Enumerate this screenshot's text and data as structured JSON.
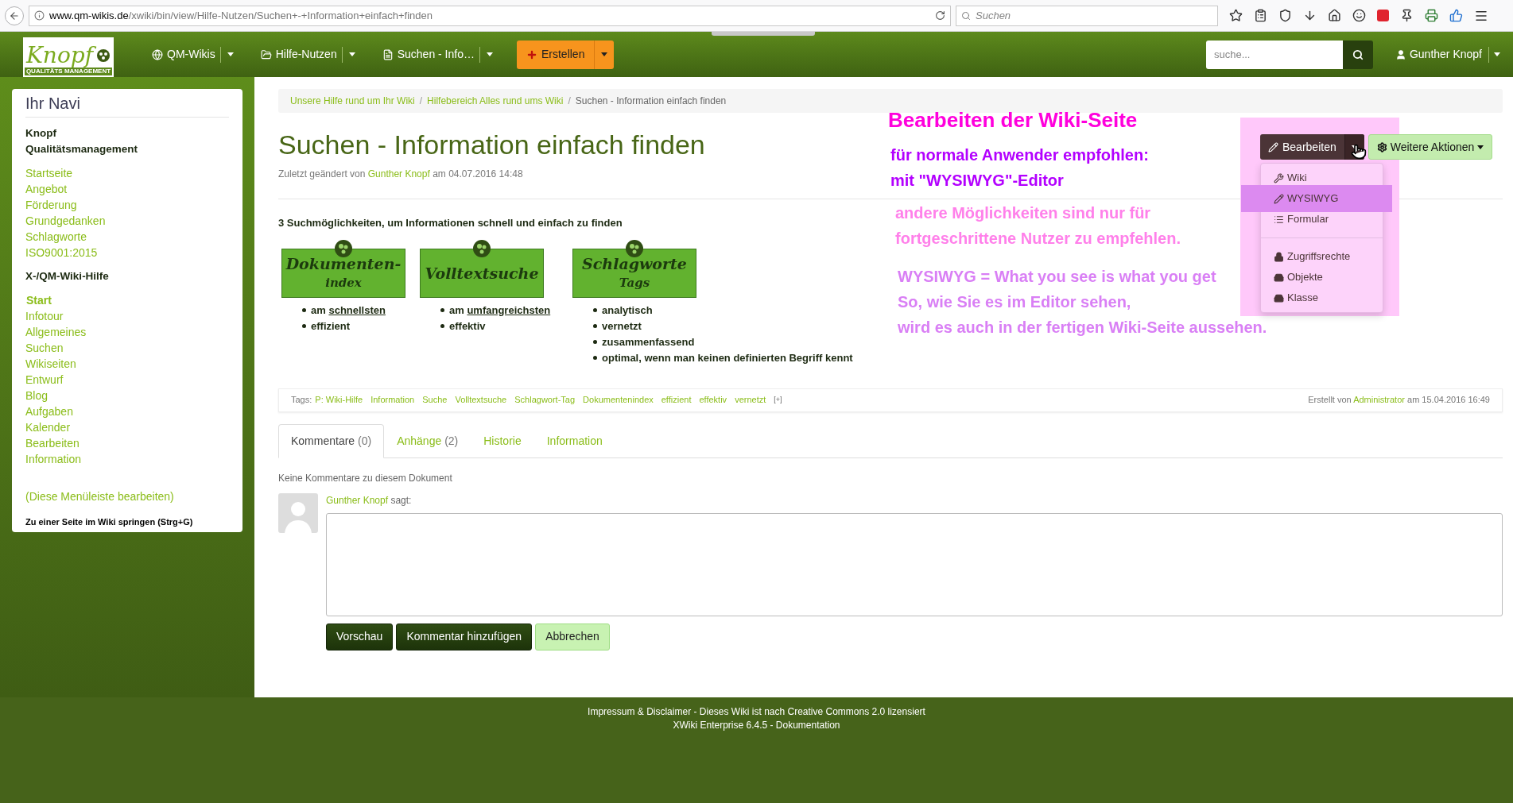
{
  "browser": {
    "url_host": "www.qm-wikis.de",
    "url_path": "/xwiki/bin/view/Hilfe-Nutzen/Suchen+-+Information+einfach+finden",
    "search_placeholder": "Suchen"
  },
  "navbar": {
    "logo": {
      "word": "Knopf",
      "tagline": "QUALITÄTS MANAGEMENT"
    },
    "menus": [
      {
        "label": "QM-Wikis"
      },
      {
        "label": "Hilfe-Nutzen"
      },
      {
        "label": "Suchen - Info…"
      }
    ],
    "create_button": "Erstellen",
    "search_placeholder": "suche...",
    "user": "Gunther Knopf"
  },
  "sidebar": {
    "title": "Ihr Navi",
    "sections": [
      {
        "heading": [
          "Knopf",
          "Qualitätsmanagement"
        ],
        "links": [
          {
            "label": "Startseite",
            "selected": false
          },
          {
            "label": "Angebot",
            "selected": false
          },
          {
            "label": "Förderung",
            "selected": false
          },
          {
            "label": "Grundgedanken",
            "selected": false
          },
          {
            "label": "Schlagworte",
            "selected": false
          },
          {
            "label": "ISO9001:2015",
            "selected": false
          }
        ]
      },
      {
        "heading": [
          "X-/QM-Wiki-Hilfe"
        ],
        "links": [
          {
            "label": "Start",
            "selected": true
          },
          {
            "label": "Infotour",
            "selected": false
          },
          {
            "label": "Allgemeines",
            "selected": false
          },
          {
            "label": "Suchen",
            "selected": false
          },
          {
            "label": "Wikiseiten",
            "selected": false
          },
          {
            "label": "Entwurf",
            "selected": false
          },
          {
            "label": "Blog",
            "selected": false
          },
          {
            "label": "Aufgaben",
            "selected": false
          },
          {
            "label": "Kalender",
            "selected": false
          },
          {
            "label": "Bearbeiten",
            "selected": false
          },
          {
            "label": "Information",
            "selected": false
          }
        ]
      }
    ],
    "edit_link": "(Diese Menüleiste bearbeiten)",
    "jump_text": "Zu einer Seite im Wiki springen (Strg+G)"
  },
  "breadcrumb": {
    "separator": "/",
    "items": [
      {
        "label": "Unsere Hilfe rund um Ihr Wiki",
        "current": false
      },
      {
        "label": "Hilfebereich Alles rund ums Wiki",
        "current": false
      },
      {
        "label": "Suchen - Information einfach finden",
        "current": true
      }
    ]
  },
  "title": "Suchen - Information einfach finden",
  "modified": {
    "prefix": "Zuletzt geändert von",
    "author": "Gunther Knopf",
    "suffix": "am 04.07.2016 14:48"
  },
  "actions": {
    "edit_button": "Bearbeiten",
    "more_button": "Weitere Aktionen",
    "edit_menu": [
      [
        {
          "label": "Wiki",
          "selected": false
        },
        {
          "label": "WYSIWYG",
          "selected": true
        },
        {
          "label": "Formular",
          "selected": false
        }
      ],
      [
        {
          "label": "Zugriffsrechte",
          "selected": false
        },
        {
          "label": "Objekte",
          "selected": false
        },
        {
          "label": "Klasse",
          "selected": false
        }
      ]
    ]
  },
  "intro": "3 Suchmöglichkeiten, um Informationen schnell und einfach zu finden",
  "methods": [
    {
      "image_lines": [
        "Dokumenten-",
        "index"
      ],
      "points": [
        {
          "text": "am",
          "link": "schnellsten"
        },
        {
          "text": "effizient"
        }
      ]
    },
    {
      "image_lines": [
        "Volltextsuche"
      ],
      "points": [
        {
          "text": "am",
          "link": "umfangreichsten"
        },
        {
          "text": "effektiv"
        }
      ]
    },
    {
      "image_lines": [
        "Schlagworte",
        "Tags"
      ],
      "points": [
        {
          "text": "analytisch"
        },
        {
          "text": "vernetzt"
        },
        {
          "text": "zusammenfassend"
        },
        {
          "text": "optimal, wenn man keinen definierten Begriff kennt"
        }
      ]
    }
  ],
  "annotations": [
    {
      "kind": "heading",
      "color": "#ff00dd",
      "lines": [
        "Bearbeiten der Wiki-Seite"
      ]
    },
    {
      "kind": "note",
      "color": "#b300ff",
      "lines": [
        "für normale Anwender empfohlen:",
        "mit \"WYSIWYG\"-Editor"
      ]
    },
    {
      "kind": "note",
      "color": "#ff80ea",
      "lines": [
        "andere Möglichkeiten sind nur für",
        "fortgeschrittene Nutzer zu empfehlen."
      ]
    },
    {
      "kind": "note",
      "color": "#d97ff5",
      "lines": [
        "WYSIWYG = What you see is what you get",
        "So, wie Sie es im Editor sehen,",
        "wird es auch in der fertigen Wiki-Seite aussehen."
      ]
    }
  ],
  "tags": {
    "label": "Tags:",
    "items": [
      "P: Wiki-Hilfe",
      "Information",
      "Suche",
      "Volltextsuche",
      "Schlagwort-Tag",
      "Dokumentenindex",
      "effizient",
      "effektiv",
      "vernetzt"
    ],
    "more": "[+]",
    "created": {
      "prefix": "Erstellt von",
      "author": "Administrator",
      "suffix": "am 15.04.2016 16:49"
    }
  },
  "tabs": [
    {
      "label": "Kommentare",
      "count": "(0)",
      "selected": true
    },
    {
      "label": "Anhänge",
      "count": "(2)",
      "selected": false
    },
    {
      "label": "Historie",
      "selected": false
    },
    {
      "label": "Information",
      "selected": false
    }
  ],
  "no_comments": "Keine Kommentare zu diesem Dokument",
  "comment_form": {
    "author": "Gunther Knopf",
    "says": "sagt:",
    "buttons": [
      {
        "label": "Vorschau",
        "kind": "dark"
      },
      {
        "label": "Kommentar hinzufügen",
        "kind": "dark"
      },
      {
        "label": "Abbrechen",
        "kind": "light"
      }
    ]
  },
  "footer": [
    "Impressum & Disclaimer - Dieses Wiki ist nach Creative Commons 2.0 lizensiert",
    "XWiki Enterprise 6.4.5 - Dokumentation"
  ]
}
